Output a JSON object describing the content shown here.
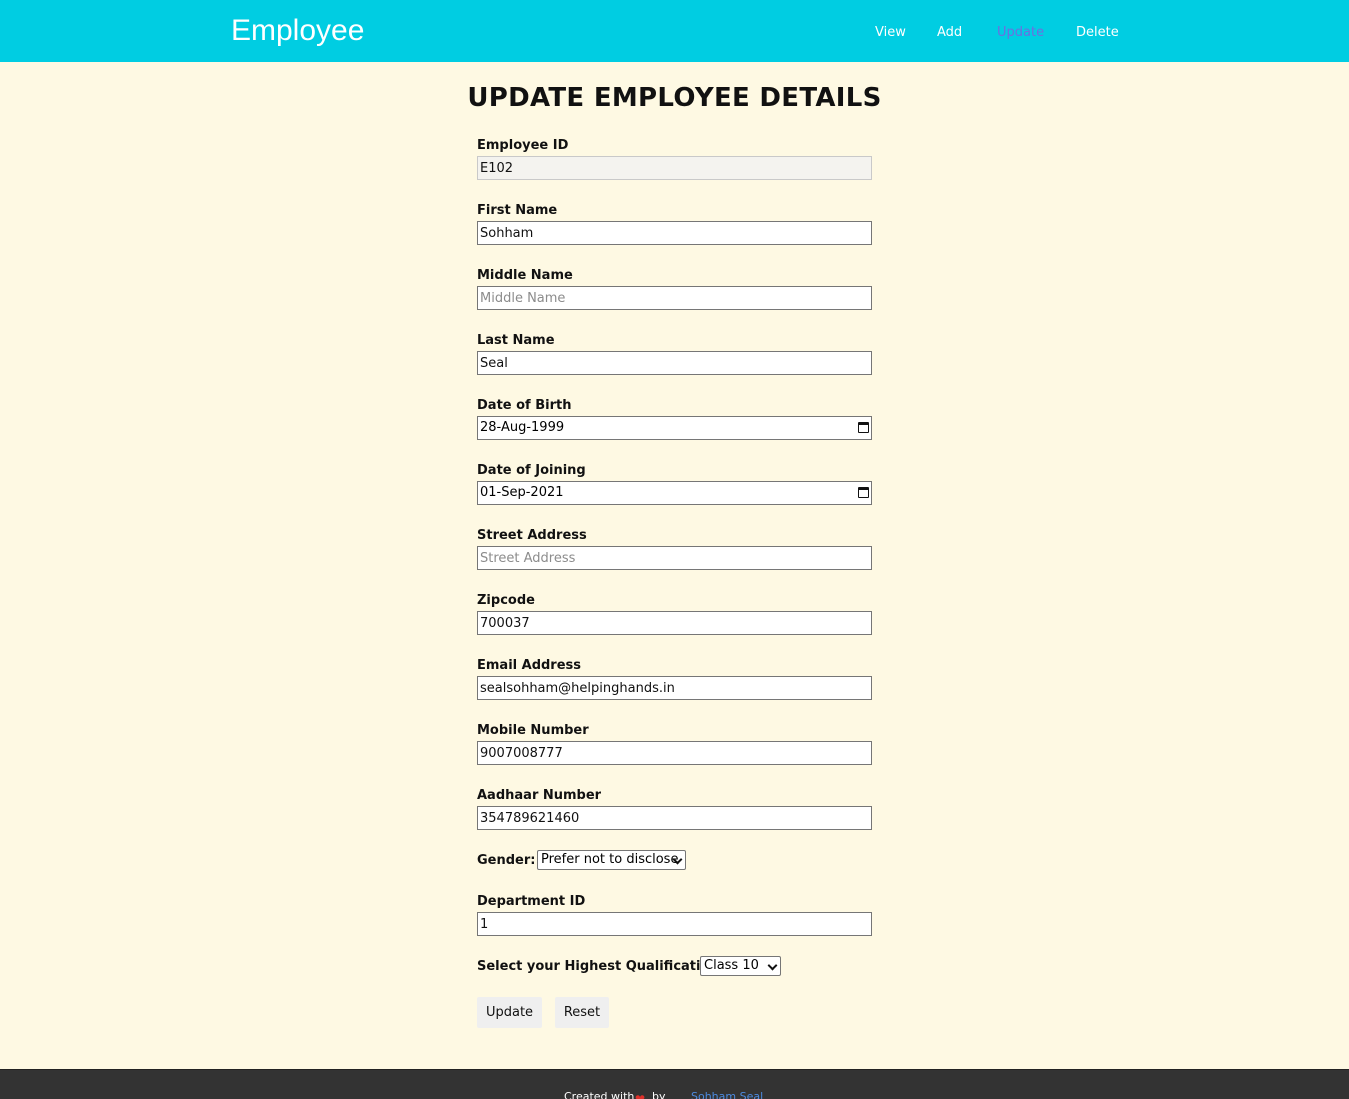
{
  "header": {
    "brand": "Employee",
    "nav": {
      "view": "View",
      "add": "Add",
      "update": "Update",
      "delete": "Delete"
    },
    "bg_color": "#00cde2",
    "active_color": "#6b6fe0"
  },
  "page_title": "UPDATE EMPLOYEE DETAILS",
  "form": {
    "employee_id": {
      "label": "Employee ID",
      "value": "E102"
    },
    "first_name": {
      "label": "First Name",
      "value": "Sohham"
    },
    "middle_name": {
      "label": "Middle Name",
      "value": "",
      "placeholder": "Middle Name"
    },
    "last_name": {
      "label": "Last Name",
      "value": "Seal"
    },
    "dob": {
      "label": "Date of Birth",
      "value": "28-Aug-1999"
    },
    "doj": {
      "label": "Date of Joining",
      "value": "01-Sep-2021"
    },
    "street": {
      "label": "Street Address",
      "value": "",
      "placeholder": "Street Address"
    },
    "zipcode": {
      "label": "Zipcode",
      "value": "700037"
    },
    "email": {
      "label": "Email Address",
      "value": "sealsohham@helpinghands.in"
    },
    "mobile": {
      "label": "Mobile Number",
      "value": "9007008777"
    },
    "aadhaar": {
      "label": "Aadhaar Number",
      "value": "354789621460"
    },
    "gender": {
      "label": "Gender:",
      "selected": "Prefer not to disclose"
    },
    "department_id": {
      "label": "Department ID",
      "value": "1"
    },
    "qualification": {
      "label": "Select your Highest Qualification:",
      "selected": "Class 10"
    },
    "update_label": "Update",
    "reset_label": "Reset"
  },
  "footer": {
    "created_with": "Created with",
    "by": "by",
    "author": "Sohham Seal",
    "heart_icon": "heart-icon"
  },
  "colors": {
    "page_bg": "#fef9e3",
    "footer_bg": "#333333"
  }
}
